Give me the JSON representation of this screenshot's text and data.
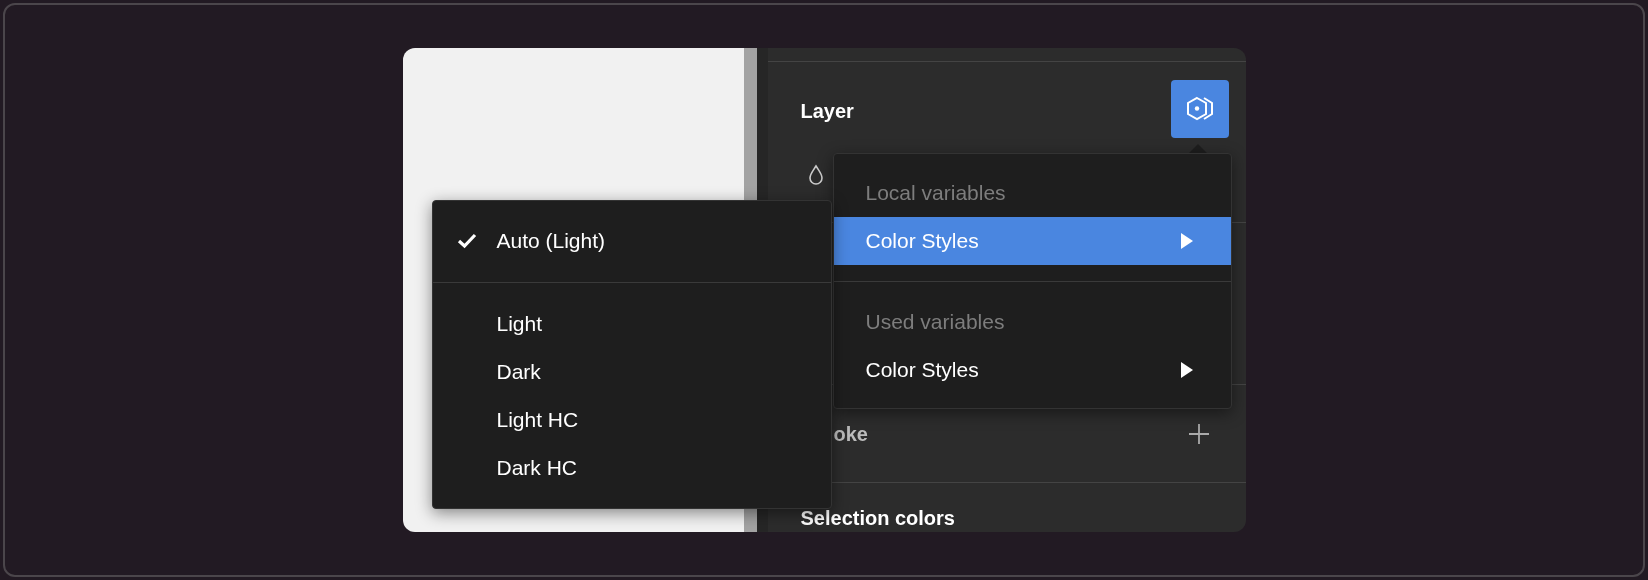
{
  "panel": {
    "title": "Layer",
    "sections": [
      {
        "kind": "add",
        "label": "oke"
      },
      {
        "kind": "plain",
        "label": "Selection colors"
      }
    ]
  },
  "theme_menu": {
    "items": [
      {
        "label": "Auto (Light)",
        "selected": true
      },
      {
        "label": "Light",
        "selected": false
      },
      {
        "label": "Dark",
        "selected": false
      },
      {
        "label": "Light HC",
        "selected": false
      },
      {
        "label": "Dark HC",
        "selected": false
      }
    ]
  },
  "variables_menu": {
    "groups": [
      {
        "heading": "Local variables",
        "items": [
          {
            "label": "Color Styles",
            "highlighted": true
          }
        ]
      },
      {
        "heading": "Used variables",
        "items": [
          {
            "label": "Color Styles",
            "highlighted": false
          }
        ]
      }
    ]
  }
}
